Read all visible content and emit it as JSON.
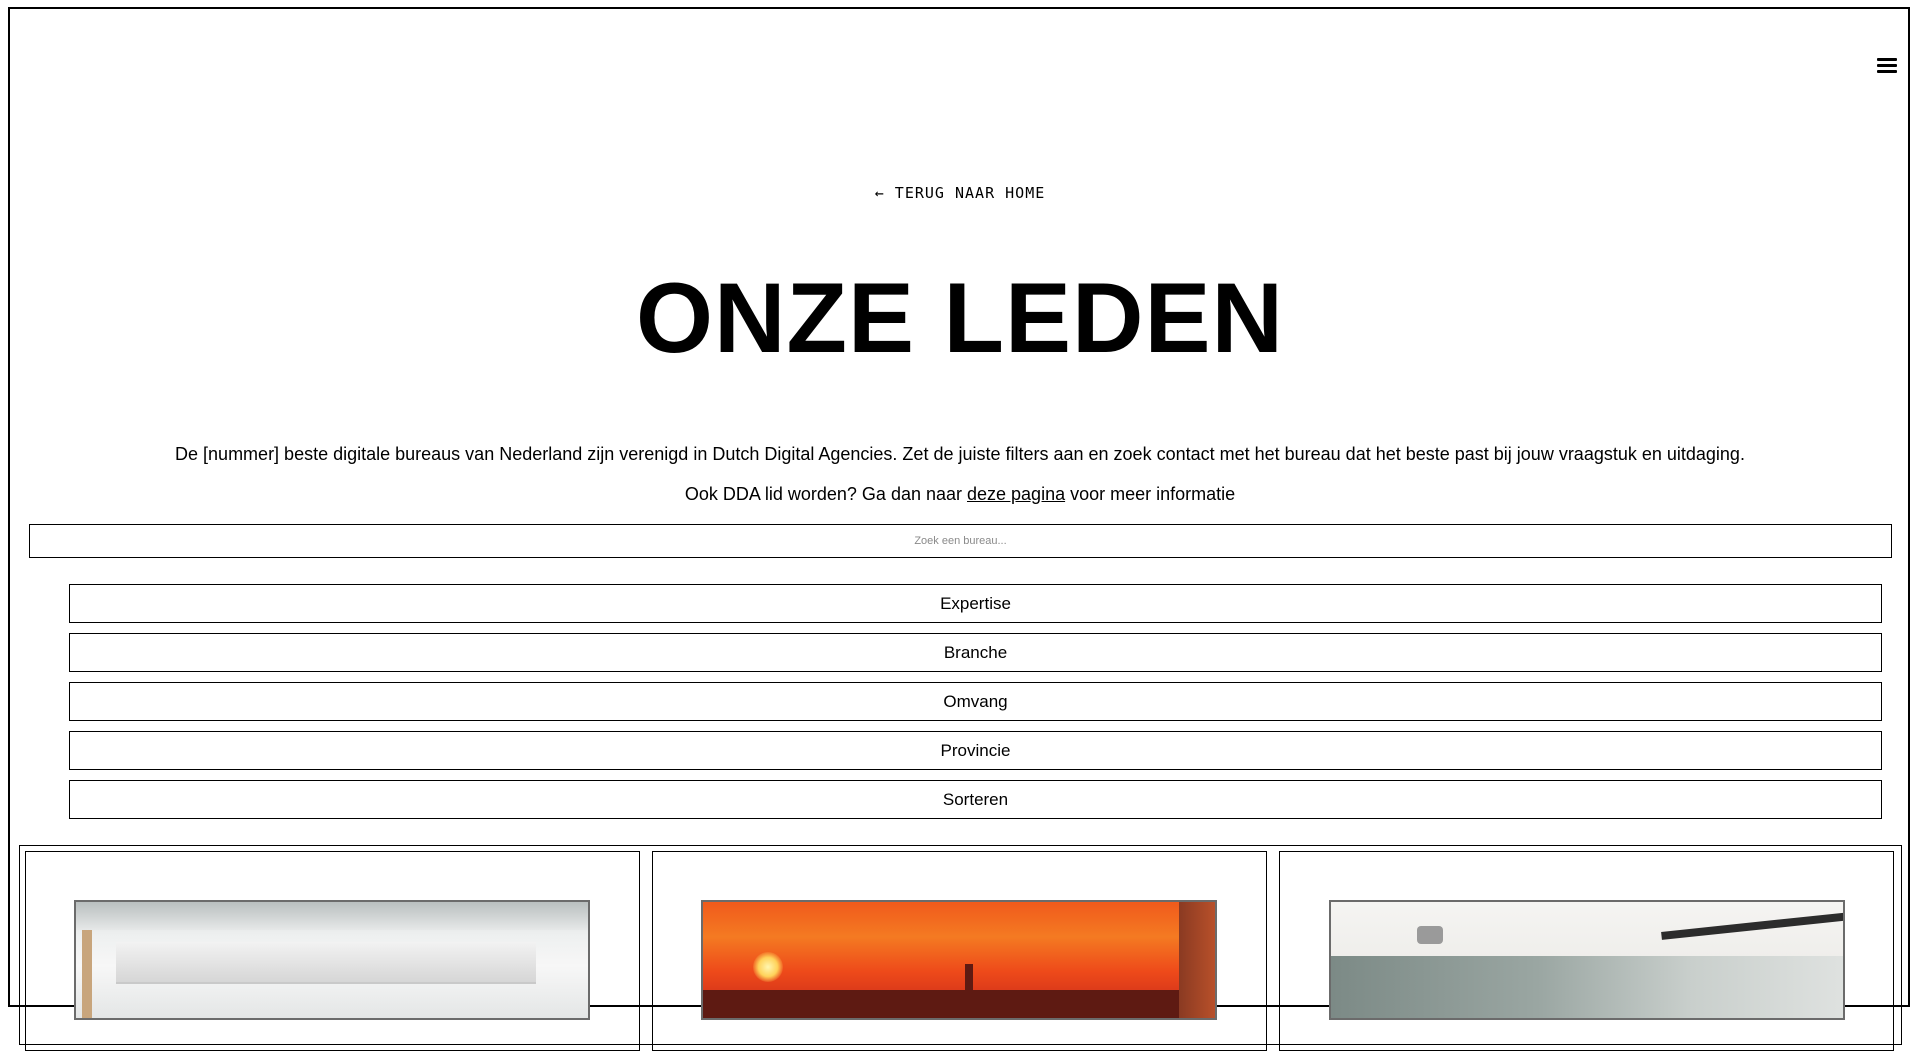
{
  "nav": {
    "menu_icon": "hamburger-menu-icon"
  },
  "header": {
    "back_link": "← TERUG NAAR HOME",
    "title": "ONZE LEDEN"
  },
  "intro": {
    "text": "De [nummer] beste digitale bureaus van Nederland zijn verenigd in Dutch Digital Agencies. Zet de juiste filters aan en zoek contact met het bureau dat het beste past bij jouw vraagstuk en uitdaging.",
    "join_prefix": "Ook DDA lid worden? Ga dan naar ",
    "join_link": "deze pagina",
    "join_suffix": " voor meer informatie"
  },
  "search": {
    "placeholder": "Zoek een bureau...",
    "value": ""
  },
  "filters": [
    {
      "label": "Expertise"
    },
    {
      "label": "Branche"
    },
    {
      "label": "Omvang"
    },
    {
      "label": "Provincie"
    },
    {
      "label": "Sorteren"
    }
  ]
}
